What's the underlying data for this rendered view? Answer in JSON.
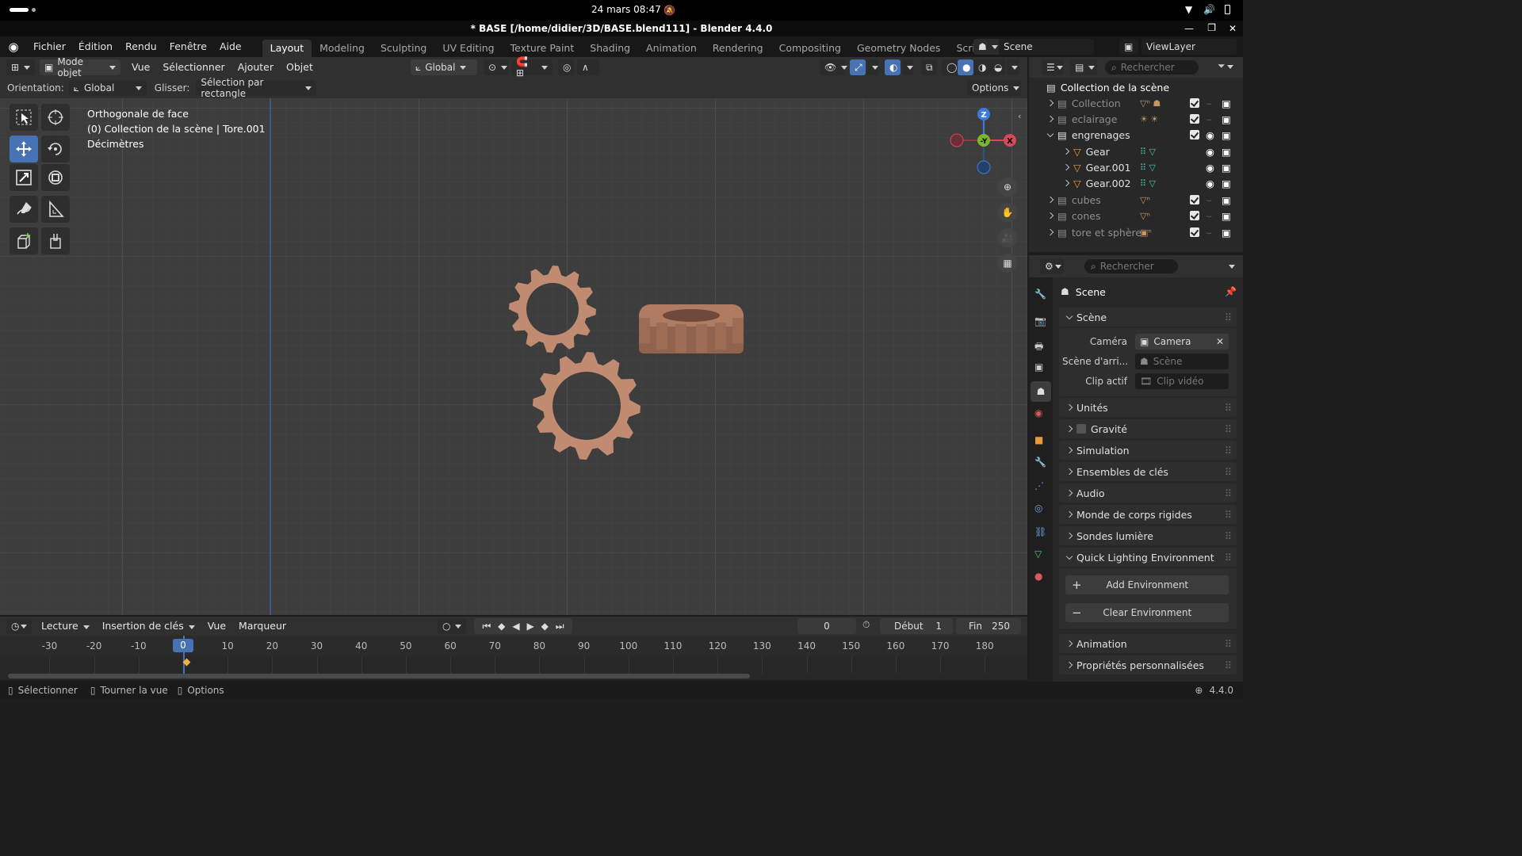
{
  "system": {
    "datetime": "24 mars  08:47"
  },
  "window": {
    "title": "* BASE [/home/didier/3D/BASE.blend111] - Blender 4.4.0"
  },
  "menus": [
    "Fichier",
    "Édition",
    "Rendu",
    "Fenêtre",
    "Aide"
  ],
  "workspaces": [
    "Layout",
    "Modeling",
    "Sculpting",
    "UV Editing",
    "Texture Paint",
    "Shading",
    "Animation",
    "Rendering",
    "Compositing",
    "Geometry Nodes",
    "Scripting"
  ],
  "active_workspace": "Layout",
  "scene_selector": "Scene",
  "viewlayer_selector": "ViewLayer",
  "viewport_header": {
    "mode": "Mode objet",
    "menus": [
      "Vue",
      "Sélectionner",
      "Ajouter",
      "Objet"
    ],
    "transform_orientation": "Global"
  },
  "tool_settings": {
    "orientation_label": "Orientation:",
    "orientation_value": "Global",
    "drag_label": "Glisser:",
    "drag_value": "Sélection par rectangle",
    "options": "Options"
  },
  "viewport_info": {
    "line1": "Orthogonale de face",
    "line2": "(0) Collection de la scène | Tore.001",
    "line3": "Décimètres"
  },
  "gizmo": {
    "z": "Z",
    "y": "-Y",
    "x": "X"
  },
  "outliner": {
    "search_placeholder": "Rechercher",
    "root": "Collection de la scène",
    "rows": [
      {
        "label": "Collection",
        "depth": 0
      },
      {
        "label": "eclairage",
        "depth": 0
      },
      {
        "label": "engrenages",
        "depth": 0
      },
      {
        "label": "Gear",
        "depth": 1
      },
      {
        "label": "Gear.001",
        "depth": 1
      },
      {
        "label": "Gear.002",
        "depth": 1
      },
      {
        "label": "cubes",
        "depth": 0
      },
      {
        "label": "cones",
        "depth": 0
      },
      {
        "label": "tore et sphère",
        "depth": 0
      }
    ]
  },
  "properties": {
    "search_placeholder": "Rechercher",
    "context_title": "Scene",
    "scene_panel": {
      "title": "Scène",
      "camera_label": "Caméra",
      "camera_value": "Camera",
      "background_label": "Scène d'arri...",
      "background_placeholder": "Scène",
      "clip_label": "Clip actif",
      "clip_placeholder": "Clip vidéo"
    },
    "panels": [
      "Unités",
      "Gravité",
      "Simulation",
      "Ensembles de clés",
      "Audio",
      "Monde de corps rigides",
      "Sondes lumière"
    ],
    "quick_lighting": {
      "title": "Quick Lighting Environment",
      "add": "Add Environment",
      "clear": "Clear Environment"
    },
    "panels_after": [
      "Animation",
      "Propriétés personnalisées"
    ]
  },
  "timeline": {
    "menus": [
      "Lecture",
      "Insertion de clés",
      "Vue",
      "Marqueur"
    ],
    "current_frame": "0",
    "start_label": "Début",
    "start_value": "1",
    "end_label": "Fin",
    "end_value": "250",
    "ticks": [
      "-30",
      "-20",
      "-10",
      "0",
      "10",
      "20",
      "30",
      "40",
      "50",
      "60",
      "70",
      "80",
      "90",
      "100",
      "110",
      "120",
      "130",
      "140",
      "150",
      "160",
      "170",
      "180"
    ]
  },
  "statusbar": {
    "select": "Sélectionner",
    "rotate": "Tourner la vue",
    "options": "Options",
    "version": "4.4.0"
  }
}
